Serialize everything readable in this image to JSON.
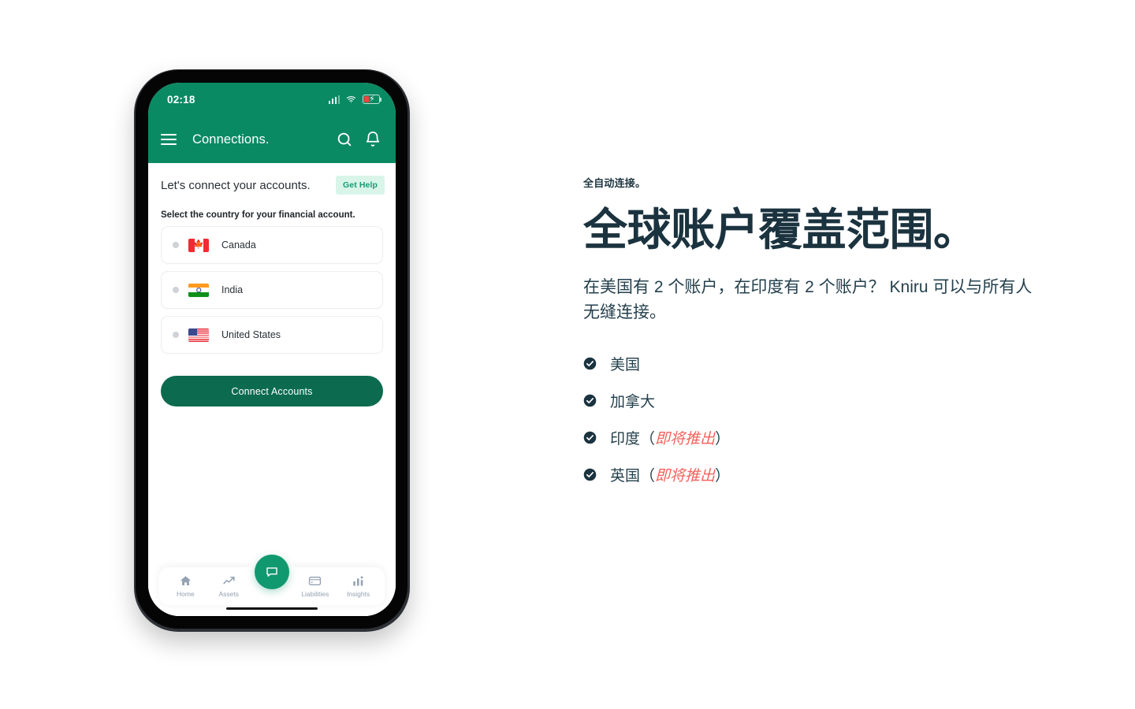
{
  "phone": {
    "status_bar": {
      "time": "02:18",
      "signal_icon": "cellular-signal-icon",
      "wifi_icon": "wifi-icon",
      "battery_icon": "battery-charging-low-icon"
    },
    "app_bar": {
      "menu_icon": "hamburger-menu-icon",
      "title": "Connections.",
      "search_icon": "search-icon",
      "notification_icon": "bell-icon"
    },
    "section": {
      "title": "Let's connect your accounts.",
      "help_label": "Get Help",
      "sub_label": "Select the country for your financial account."
    },
    "countries": [
      {
        "name": "Canada",
        "flag": "flag-canada",
        "selected": false
      },
      {
        "name": "India",
        "flag": "flag-india",
        "selected": false
      },
      {
        "name": "United States",
        "flag": "flag-united-states",
        "selected": false
      }
    ],
    "primary_button": "Connect Accounts",
    "bottom_nav": {
      "items": [
        {
          "label": "Home",
          "icon": "home-icon"
        },
        {
          "label": "Assets",
          "icon": "trending-up-icon"
        },
        {
          "label": "Liabilities",
          "icon": "credit-card-icon"
        },
        {
          "label": "Insights",
          "icon": "bar-chart-icon"
        }
      ],
      "fab_icon": "chat-bubble-icon"
    },
    "colors": {
      "header_green": "#0a8a63",
      "button_green": "#0c6b4f",
      "fab_green": "#10996e",
      "help_badge_bg": "#d9f5ea",
      "help_badge_text": "#169b73"
    }
  },
  "copy": {
    "eyebrow": "全自动连接。",
    "headline": "全球账户覆盖范围。",
    "lede": "在美国有 2 个账户，在印度有 2 个账户？ Kniru 可以与所有人无缝连接。",
    "checklist": [
      {
        "icon": "check-circle-icon",
        "label": "美国",
        "note": ""
      },
      {
        "icon": "check-circle-icon",
        "label": "加拿大",
        "note": ""
      },
      {
        "icon": "check-circle-icon",
        "label": "印度",
        "note": "即将推出"
      },
      {
        "icon": "check-circle-icon",
        "label": "英国",
        "note": "即将推出"
      }
    ],
    "note_open": "（",
    "note_close": "）",
    "colors": {
      "headline": "#1b333f",
      "body": "#24404d",
      "coming_soon": "#f4625c"
    }
  }
}
